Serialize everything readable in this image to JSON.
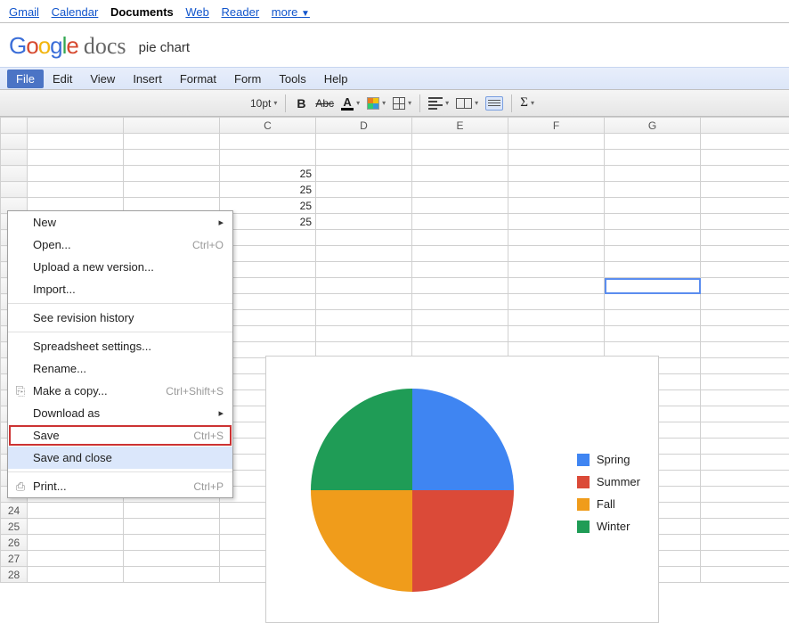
{
  "top_nav": {
    "links": [
      "Gmail",
      "Calendar",
      "Documents",
      "Web",
      "Reader",
      "more"
    ],
    "active_index": 2
  },
  "logo_text": "docs",
  "doc_title": "pie chart",
  "menubar": [
    "File",
    "Edit",
    "View",
    "Insert",
    "Format",
    "Form",
    "Tools",
    "Help"
  ],
  "active_menu_index": 0,
  "toolbar": {
    "font_size": "10pt"
  },
  "file_menu": {
    "items": [
      {
        "label": "New",
        "submenu": true
      },
      {
        "label": "Open...",
        "shortcut": "Ctrl+O"
      },
      {
        "label": "Upload a new version..."
      },
      {
        "label": "Import..."
      },
      {
        "sep": true
      },
      {
        "label": "See revision history"
      },
      {
        "sep": true
      },
      {
        "label": "Spreadsheet settings..."
      },
      {
        "label": "Rename..."
      },
      {
        "label": "Make a copy...",
        "shortcut": "Ctrl+Shift+S",
        "icon": "copy"
      },
      {
        "label": "Download as",
        "submenu": true
      },
      {
        "label": "Save",
        "shortcut": "Ctrl+S",
        "highlight": true
      },
      {
        "label": "Save and close",
        "hover": true
      },
      {
        "sep": true
      },
      {
        "label": "Print...",
        "shortcut": "Ctrl+P",
        "icon": "print"
      }
    ]
  },
  "columns": [
    "",
    "",
    "C",
    "D",
    "E",
    "F",
    "G"
  ],
  "cells": {
    "C3": "25",
    "C4": "25",
    "C5": "25",
    "C6": "25"
  },
  "row_start": 17,
  "row_end": 28,
  "selected_cell": "G10",
  "chart_data": {
    "type": "pie",
    "series": [
      {
        "name": "Spring",
        "value": 25,
        "color": "#3f85f2"
      },
      {
        "name": "Summer",
        "value": 25,
        "color": "#db4a38"
      },
      {
        "name": "Fall",
        "value": 25,
        "color": "#f09c1b"
      },
      {
        "name": "Winter",
        "value": 25,
        "color": "#1f9c56"
      }
    ]
  }
}
